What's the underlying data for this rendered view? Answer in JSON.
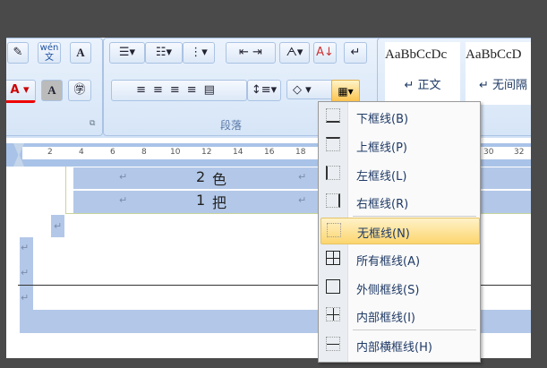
{
  "ribbon": {
    "paragraph_group_label": "段落",
    "phonetic_label": "wén 文",
    "styles": [
      {
        "preview": "AaBbCcDc",
        "name": "正文"
      },
      {
        "preview": "AaBbCcD",
        "name": "无间隔"
      }
    ],
    "border_button_state": "active"
  },
  "ruler": {
    "ticks": [
      "2",
      "4",
      "6",
      "8",
      "10",
      "12",
      "14",
      "16",
      "18",
      "30",
      "32"
    ]
  },
  "document": {
    "rows": [
      {
        "num": "2",
        "char": "色"
      },
      {
        "num": "1",
        "char": "把"
      }
    ],
    "para_mark": "↵"
  },
  "border_menu": {
    "items": [
      {
        "label": "下框线(B)",
        "icon": "bottom-border-icon"
      },
      {
        "label": "上框线(P)",
        "icon": "top-border-icon"
      },
      {
        "label": "左框线(L)",
        "icon": "left-border-icon"
      },
      {
        "label": "右框线(R)",
        "icon": "right-border-icon"
      },
      {
        "label": "无框线(N)",
        "icon": "no-border-icon",
        "highlighted": true
      },
      {
        "label": "所有框线(A)",
        "icon": "all-borders-icon"
      },
      {
        "label": "外侧框线(S)",
        "icon": "outside-borders-icon"
      },
      {
        "label": "内部框线(I)",
        "icon": "inside-borders-icon"
      },
      {
        "label": "内部横框线(H)",
        "icon": "inside-horizontal-border-icon"
      }
    ]
  }
}
